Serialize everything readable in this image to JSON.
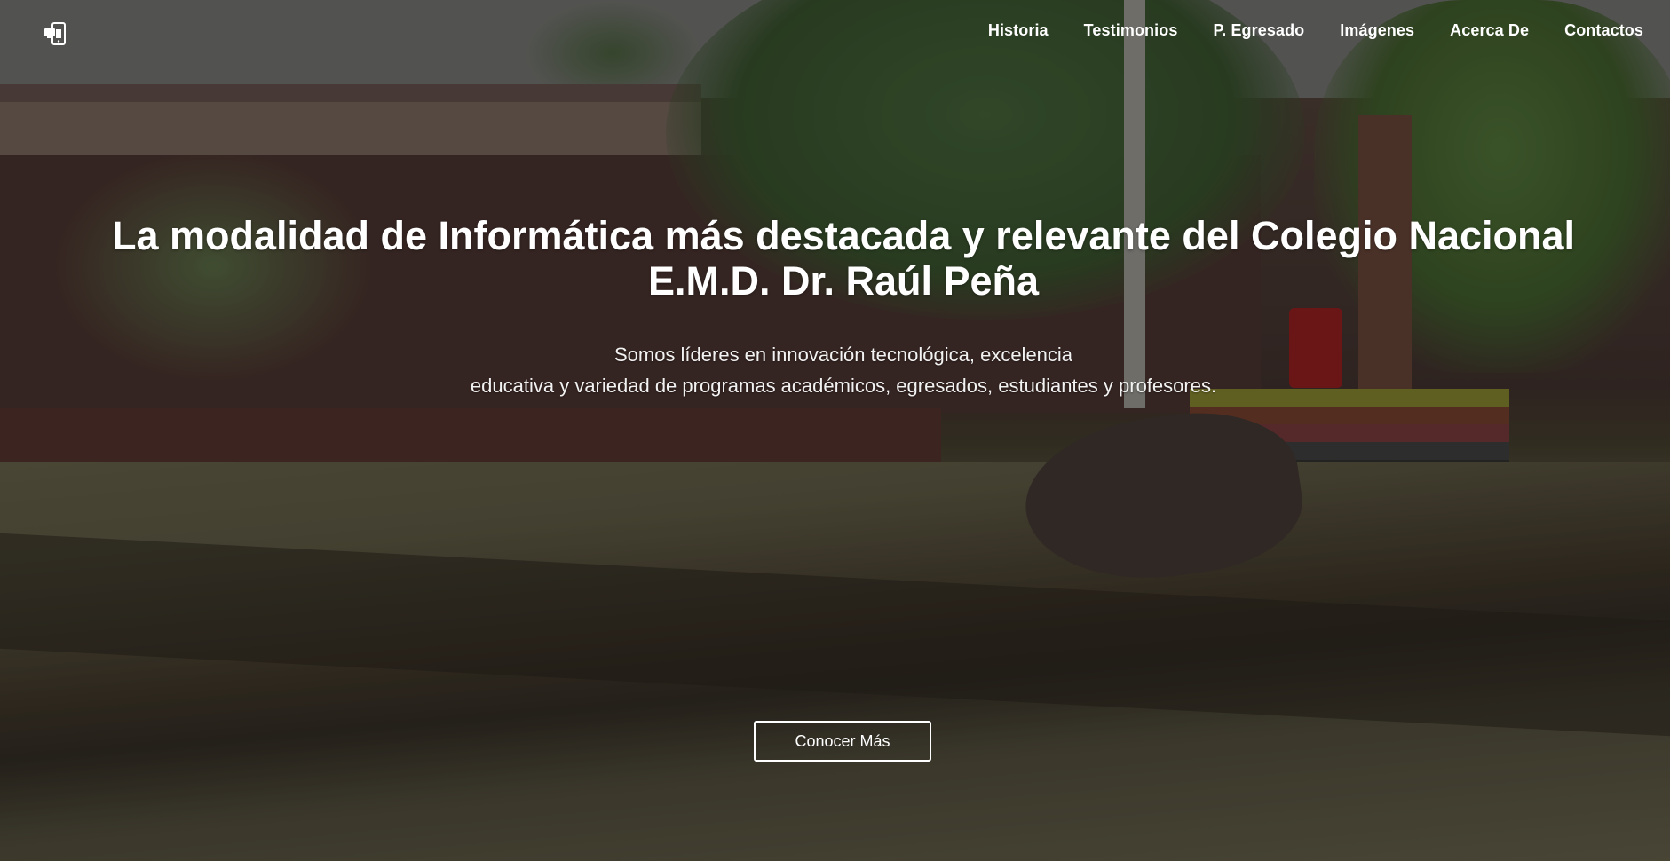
{
  "navbar": {
    "logo_icon": "devices-icon",
    "links": [
      {
        "label": "Historia"
      },
      {
        "label": "Testimonios"
      },
      {
        "label": "P. Egresado"
      },
      {
        "label": "Imágenes"
      },
      {
        "label": "Acerca De"
      },
      {
        "label": "Contactos"
      }
    ]
  },
  "hero": {
    "title": "La modalidad de Informática más destacada y relevante del Colegio Nacional E.M.D. Dr. Raúl Peña",
    "subtitle_line1": "Somos líderes en innovación tecnológica, excelencia",
    "subtitle_line2": "educativa y variedad de programas académicos, egresados, estudiantes y profesores.",
    "cta_label": "Conocer Más"
  },
  "colors": {
    "text": "#ffffff",
    "overlay": "rgba(0,0,0,0.22)"
  }
}
